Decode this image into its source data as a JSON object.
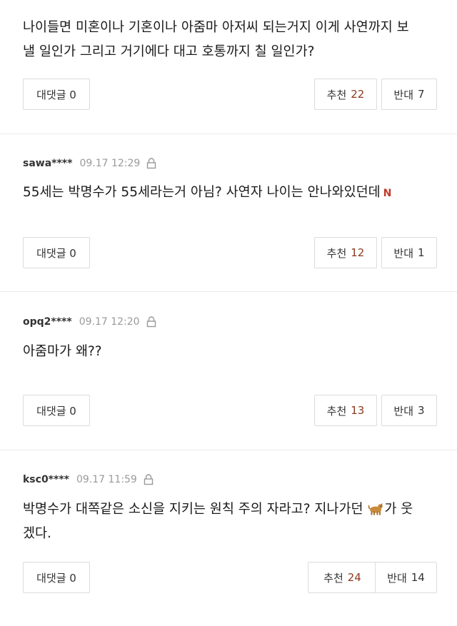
{
  "comments": [
    {
      "user": "",
      "time": "",
      "lines": [
        "나이들면 미혼이나 기혼이나 아줌마 아저씨 되는거지 이게 사연까지 보",
        "낼 일인가 그리고 거기에다 대고 호통까지 칠 일인가?"
      ],
      "reply_label": "대댓글 0",
      "up_label": "추천",
      "up_count": "22",
      "down_label": "반대",
      "down_count": "7"
    },
    {
      "user": "sawa****",
      "time": "09.17 12:29",
      "lines": [
        "55세는 박명수가 55세라는거 아님? 사연자 나이는 안나와있던데"
      ],
      "badge": "N",
      "reply_label": "대댓글 0",
      "up_label": "추천",
      "up_count": "12",
      "down_label": "반대",
      "down_count": "1"
    },
    {
      "user": "opq2****",
      "time": "09.17 12:20",
      "lines": [
        "아줌마가 왜??"
      ],
      "reply_label": "대댓글 0",
      "up_label": "추천",
      "up_count": "13",
      "down_label": "반대",
      "down_count": "3"
    },
    {
      "user": "ksc0****",
      "time": "09.17 11:59",
      "lines": [
        "박명수가 대쪽같은 소신을 지키는 원칙 주의 자라고? 지나가던",
        "가 웃",
        "겠다."
      ],
      "reply_label": "대댓글 0",
      "up_label": "추천",
      "up_count": "24",
      "down_label": "반대",
      "down_count": "14"
    }
  ],
  "icons": {
    "lock": "lock-icon",
    "dog_emoji": "dog-emoji-icon",
    "new_badge": "new-badge"
  },
  "colors": {
    "recommend_count": "#8b3a1f",
    "badge": "#c0392b",
    "meta_gray": "#9a9a9a"
  }
}
